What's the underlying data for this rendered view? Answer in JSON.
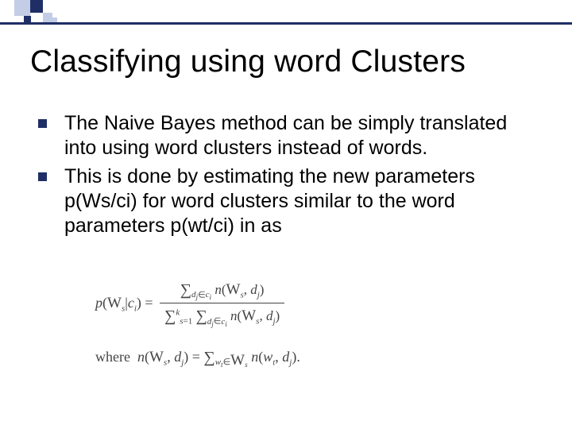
{
  "title": "Classifying using word Clusters",
  "bullets": [
    "The Naive Bayes method can be simply translated into using word clusters instead of words.",
    "This is done by estimating the new parameters p(Ws/ci) for word clusters similar to the word parameters p(wt/ci) in as"
  ],
  "formula": {
    "main_lhs": "p(𝒲ₛ|cᵢ) =",
    "main_num": "∑_{dⱼ∈cᵢ} n(𝒲ₛ, dⱼ)",
    "main_den": "∑_{s=1}^{k} ∑_{dⱼ∈cᵢ} n(𝒲ₛ, dⱼ)",
    "where_label": "where",
    "where_rhs": "n(𝒲ₛ, dⱼ) = ∑_{wₜ∈𝒲ₛ} n(wₜ, dⱼ)."
  }
}
